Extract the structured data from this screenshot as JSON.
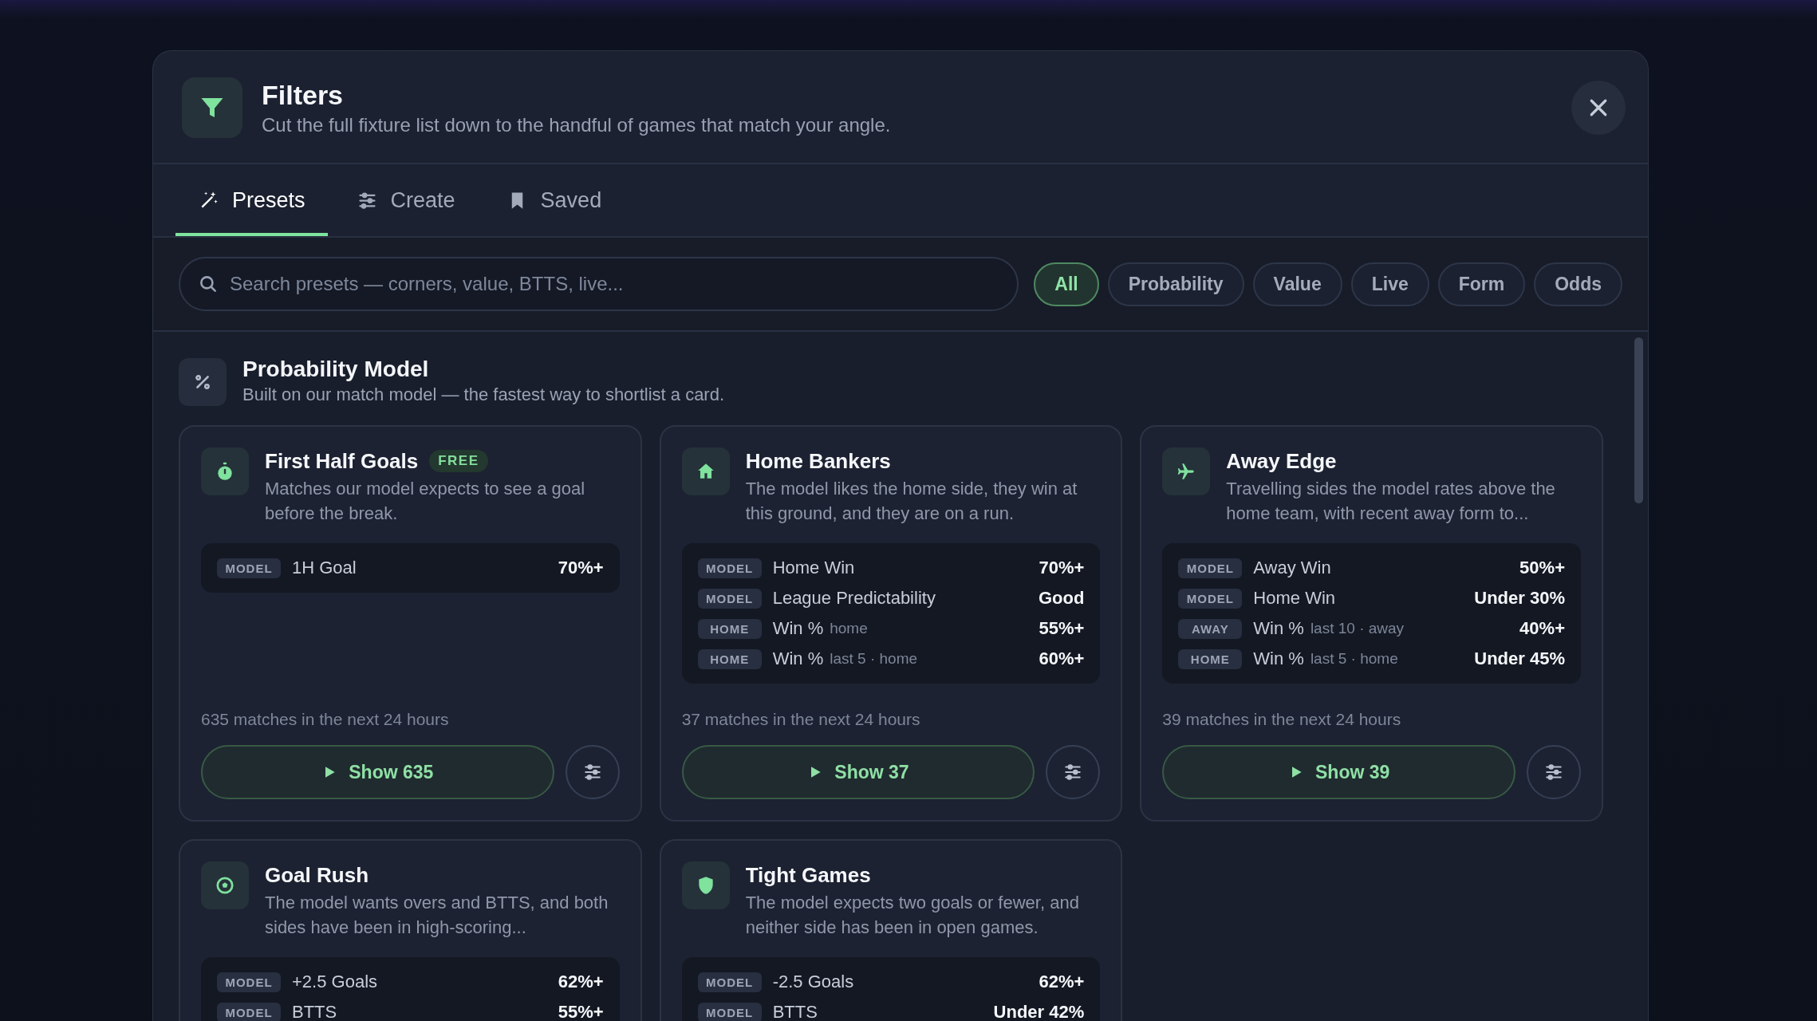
{
  "dialog": {
    "title": "Filters",
    "subtitle": "Cut the full fixture list down to the handful of games that match your angle."
  },
  "tabs": [
    {
      "label": "Presets",
      "selected": true
    },
    {
      "label": "Create",
      "selected": false
    },
    {
      "label": "Saved",
      "selected": false
    }
  ],
  "search": {
    "placeholder": "Search presets — corners, value, BTTS, live..."
  },
  "chips": [
    {
      "label": "All",
      "selected": true
    },
    {
      "label": "Probability",
      "selected": false
    },
    {
      "label": "Value",
      "selected": false
    },
    {
      "label": "Live",
      "selected": false
    },
    {
      "label": "Form",
      "selected": false
    },
    {
      "label": "Odds",
      "selected": false
    }
  ],
  "section": {
    "title": "Probability Model",
    "description": "Built on our match model — the fastest way to shortlist a card."
  },
  "presets": [
    {
      "title": "First Half Goals",
      "badge": "FREE",
      "description": "Matches our model expects to see a goal before the break.",
      "criteria": [
        {
          "tag": "MODEL",
          "label": "1H Goal",
          "value": "70%+"
        }
      ],
      "count": "635 matches in the next 24 hours",
      "button": "Show 635"
    },
    {
      "title": "Home Bankers",
      "description": "The model likes the home side, they win at this ground, and they are on a run.",
      "criteria": [
        {
          "tag": "MODEL",
          "label": "Home Win",
          "value": "70%+"
        },
        {
          "tag": "MODEL",
          "label": "League Predictability",
          "value": "Good"
        },
        {
          "tag": "HOME",
          "label": "Win %",
          "note": "home",
          "value": "55%+"
        },
        {
          "tag": "HOME",
          "label": "Win %",
          "note": "last 5 · home",
          "value": "60%+"
        }
      ],
      "count": "37 matches in the next 24 hours",
      "button": "Show 37"
    },
    {
      "title": "Away Edge",
      "description": "Travelling sides the model rates above the home team, with recent away form to...",
      "criteria": [
        {
          "tag": "MODEL",
          "label": "Away Win",
          "value": "50%+"
        },
        {
          "tag": "MODEL",
          "label": "Home Win",
          "value": "Under 30%"
        },
        {
          "tag": "AWAY",
          "label": "Win %",
          "note": "last 10 · away",
          "value": "40%+"
        },
        {
          "tag": "HOME",
          "label": "Win %",
          "note": "last 5 · home",
          "value": "Under 45%"
        }
      ],
      "count": "39 matches in the next 24 hours",
      "button": "Show 39"
    },
    {
      "title": "Goal Rush",
      "description": "The model wants overs and BTTS, and both sides have been in high-scoring...",
      "criteria": [
        {
          "tag": "MODEL",
          "label": "+2.5 Goals",
          "value": "62%+"
        },
        {
          "tag": "MODEL",
          "label": "BTTS",
          "value": "55%+"
        }
      ]
    },
    {
      "title": "Tight Games",
      "description": "The model expects two goals or fewer, and neither side has been in open games.",
      "criteria": [
        {
          "tag": "MODEL",
          "label": "-2.5 Goals",
          "value": "62%+"
        },
        {
          "tag": "MODEL",
          "label": "BTTS",
          "value": "Under 42%"
        }
      ]
    }
  ]
}
